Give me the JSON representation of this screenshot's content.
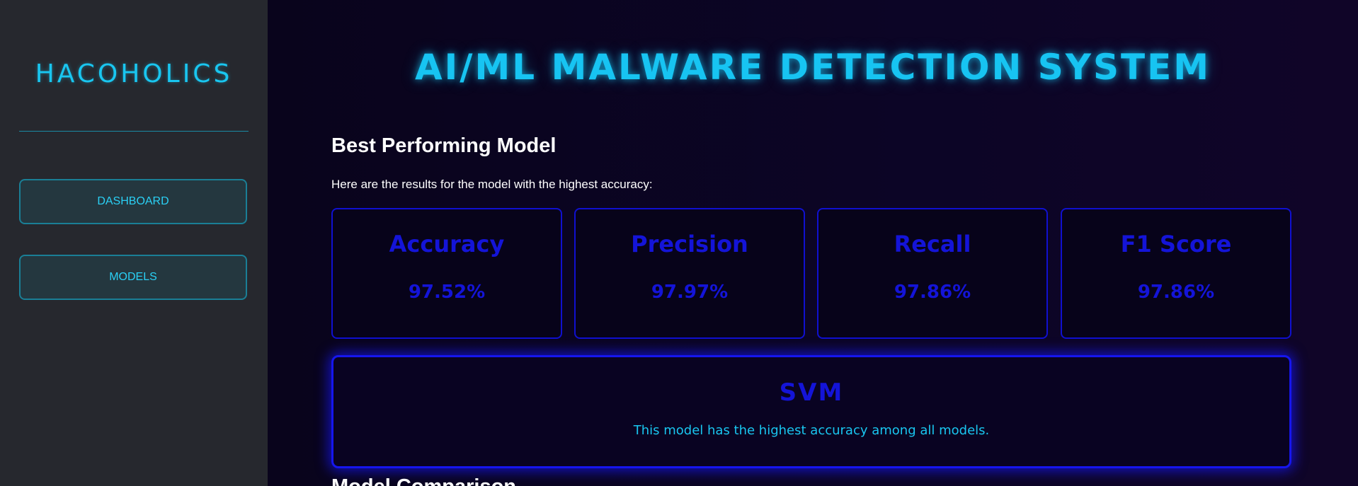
{
  "sidebar": {
    "brand": "HACOHOLICS",
    "nav": [
      {
        "label": "DASHBOARD"
      },
      {
        "label": "MODELS"
      }
    ]
  },
  "main": {
    "title": "AI/ML MALWARE DETECTION SYSTEM",
    "best_section": {
      "heading": "Best Performing Model",
      "intro": "Here are the results for the model with the highest accuracy:"
    },
    "metrics": [
      {
        "name": "Accuracy",
        "value": "97.52%"
      },
      {
        "name": "Precision",
        "value": "97.97%"
      },
      {
        "name": "Recall",
        "value": "97.86%"
      },
      {
        "name": "F1 Score",
        "value": "97.86%"
      }
    ],
    "best_model": {
      "name": "SVM",
      "description": "This model has the highest accuracy among all models."
    },
    "comparison_heading": "Model Comparison"
  },
  "colors": {
    "sidebar_bg": "#26282e",
    "main_bg": "#0a0420",
    "accent_cyan": "#19c6f0",
    "accent_blue": "#1414d8"
  }
}
